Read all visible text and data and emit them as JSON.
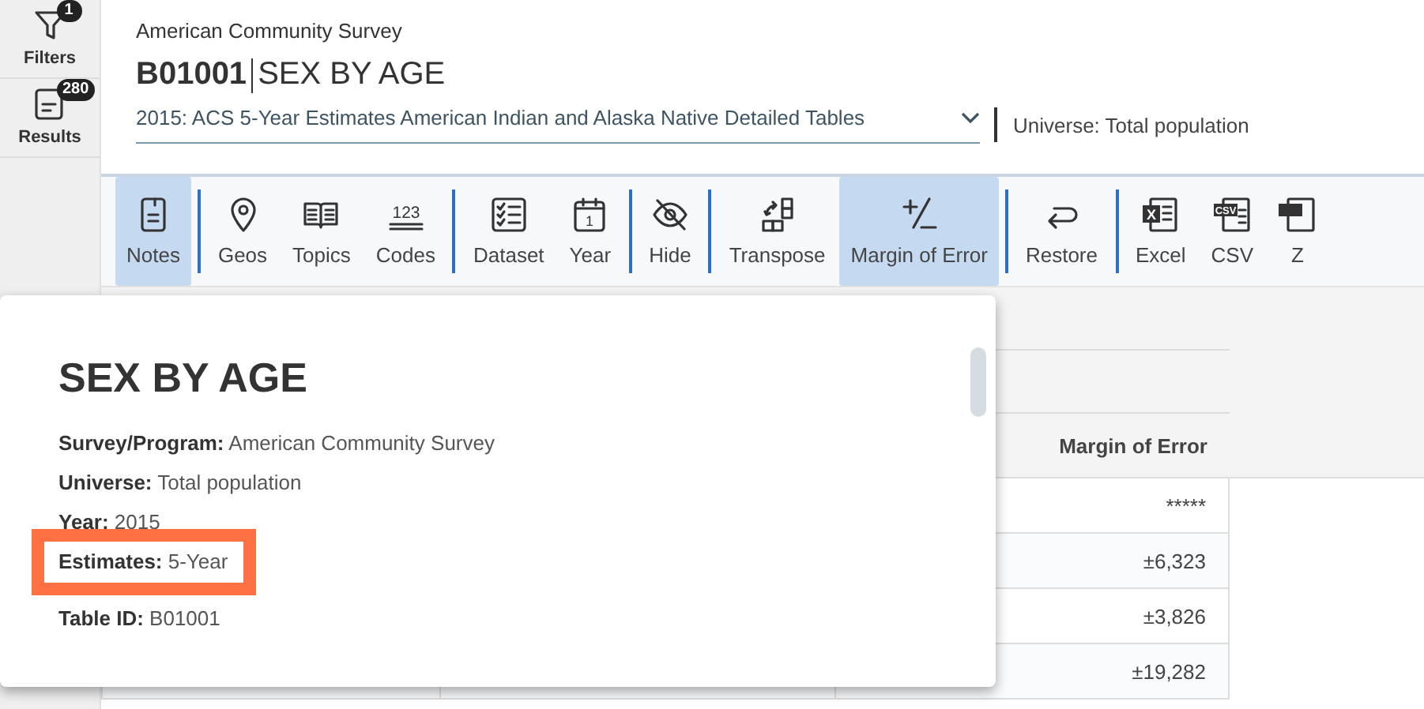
{
  "rail": [
    {
      "label": "Filters",
      "badge": "1"
    },
    {
      "label": "Results",
      "badge": "280"
    }
  ],
  "header": {
    "survey": "American Community Survey",
    "table_id": "B01001",
    "title": "SEX BY AGE",
    "dataset": "2015: ACS 5-Year Estimates American Indian and Alaska Native Detailed Tables",
    "universe": "Universe: Total population"
  },
  "toolbar": {
    "groups": [
      [
        {
          "label": "Notes",
          "selected": true
        }
      ],
      [
        {
          "label": "Geos",
          "selected": false
        },
        {
          "label": "Topics",
          "selected": false
        },
        {
          "label": "Codes",
          "icon_text": "123",
          "selected": false
        }
      ],
      [
        {
          "label": "Dataset",
          "selected": false
        },
        {
          "label": "Year",
          "icon_text": "1",
          "selected": false
        }
      ],
      [
        {
          "label": "Hide",
          "selected": false
        }
      ],
      [
        {
          "label": "Transpose",
          "selected": false
        },
        {
          "label": "Margin of Error",
          "selected": true
        }
      ],
      [
        {
          "label": "Restore",
          "selected": false
        }
      ],
      [
        {
          "label": "Excel",
          "icon_text": "X",
          "selected": false
        },
        {
          "label": "CSV",
          "icon_text": "CSV",
          "selected": false
        },
        {
          "label": "Z",
          "selected": false
        }
      ]
    ]
  },
  "table": {
    "columns": [
      "Margin of Error"
    ],
    "rows": [
      {
        "margin_of_error": "*****"
      },
      {
        "margin_of_error": "±6,323"
      },
      {
        "margin_of_error": "±3,826"
      },
      {
        "margin_of_error": "±19,282"
      }
    ]
  },
  "notes_popup": {
    "title": "SEX BY AGE",
    "lines": [
      {
        "text": "**Survey/Program:** American Community Survey",
        "highlighted": false
      },
      {
        "text": "**Universe:** Total population",
        "highlighted": false
      },
      {
        "text": "**Year:** 2015",
        "highlighted": false
      },
      {
        "text": "**Estimates:** 5-Year",
        "highlighted": true
      },
      {
        "text": "**Table ID:** B01001",
        "highlighted": false
      }
    ]
  }
}
